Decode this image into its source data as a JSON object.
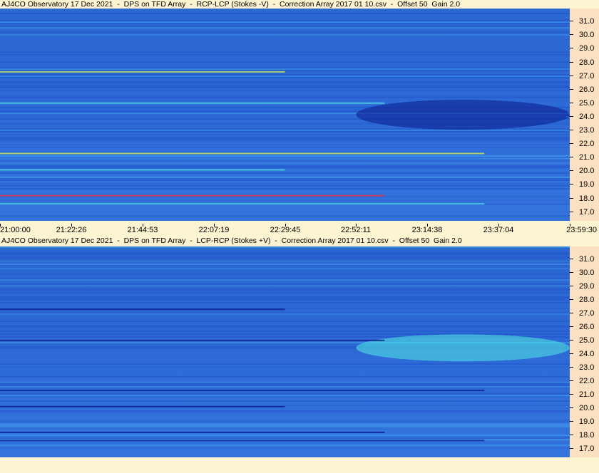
{
  "panels": [
    {
      "title": "AJ4CO Observatory 17 Dec 2021  -  DPS on TFD Array  -  RCP-LCP (Stokes -V)  -  Correction Array 2017 01 10.csv  -  Offset 50  Gain 2.0"
    },
    {
      "title": "AJ4CO Observatory 17 Dec 2021  -  DPS on TFD Array  -  LCP-RCP (Stokes +V)  -  Correction Array 2017 01 10.csv  -  Offset 50  Gain 2.0"
    }
  ],
  "chart_data": [
    {
      "type": "heatmap",
      "title": "AJ4CO Observatory 17 Dec 2021  -  DPS on TFD Array  -  RCP-LCP (Stokes -V)  -  Correction Array 2017 01 10.csv  -  Offset 50  Gain 2.0",
      "x_tick_labels": [
        "21:00:00",
        "21:22:26",
        "21:44:53",
        "22:07:19",
        "22:29:45",
        "22:52:11",
        "23:14:38",
        "23:37:04",
        "23:59:30"
      ],
      "y_tick_labels": [
        "31.0",
        "30.0",
        "29.0",
        "28.0",
        "27.0",
        "26.0",
        "25.0",
        "24.0",
        "23.0",
        "22.0",
        "21.0",
        "20.0",
        "19.0",
        "18.0",
        "17.0"
      ],
      "x_range": [
        "21:00:00",
        "23:59:30"
      ],
      "y_range_mhz": [
        16.3,
        31.9
      ],
      "colormap": [
        "#0a1a8a",
        "#1e50c8",
        "#2c6ad6",
        "#3fa0ee",
        "#4fe0e0",
        "#d0f050",
        "#f03030"
      ],
      "features": [
        {
          "kind": "dark-band",
          "x_start": "22:52:11",
          "x_end": "23:59:30",
          "y_center_mhz": 24.1,
          "y_width_mhz": 2.2
        },
        {
          "kind": "bright-lines",
          "freqs_mhz": [
            27.3,
            25.0,
            21.3,
            20.1,
            18.2,
            17.6
          ]
        }
      ]
    },
    {
      "type": "heatmap",
      "title": "AJ4CO Observatory 17 Dec 2021  -  DPS on TFD Array  -  LCP-RCP (Stokes +V)  -  Correction Array 2017 01 10.csv  -  Offset 50  Gain 2.0",
      "y_tick_labels": [
        "31.0",
        "30.0",
        "29.0",
        "28.0",
        "27.0",
        "26.0",
        "25.0",
        "24.0",
        "23.0",
        "22.0",
        "21.0",
        "20.0",
        "19.0",
        "18.0",
        "17.0"
      ],
      "x_range": [
        "21:00:00",
        "23:59:30"
      ],
      "y_range_mhz": [
        16.3,
        31.9
      ],
      "colormap": [
        "#0a1a8a",
        "#1e50c8",
        "#2c6ad6",
        "#3fa0ee",
        "#4fe0e0",
        "#d0f050",
        "#f03030"
      ],
      "features": [
        {
          "kind": "bright-band",
          "x_start": "22:52:11",
          "x_end": "23:59:30",
          "y_center_mhz": 24.4,
          "y_width_mhz": 2.0
        },
        {
          "kind": "dark-lines",
          "freqs_mhz": [
            27.3,
            25.0,
            21.3,
            20.1,
            18.2,
            17.6
          ]
        }
      ]
    }
  ]
}
